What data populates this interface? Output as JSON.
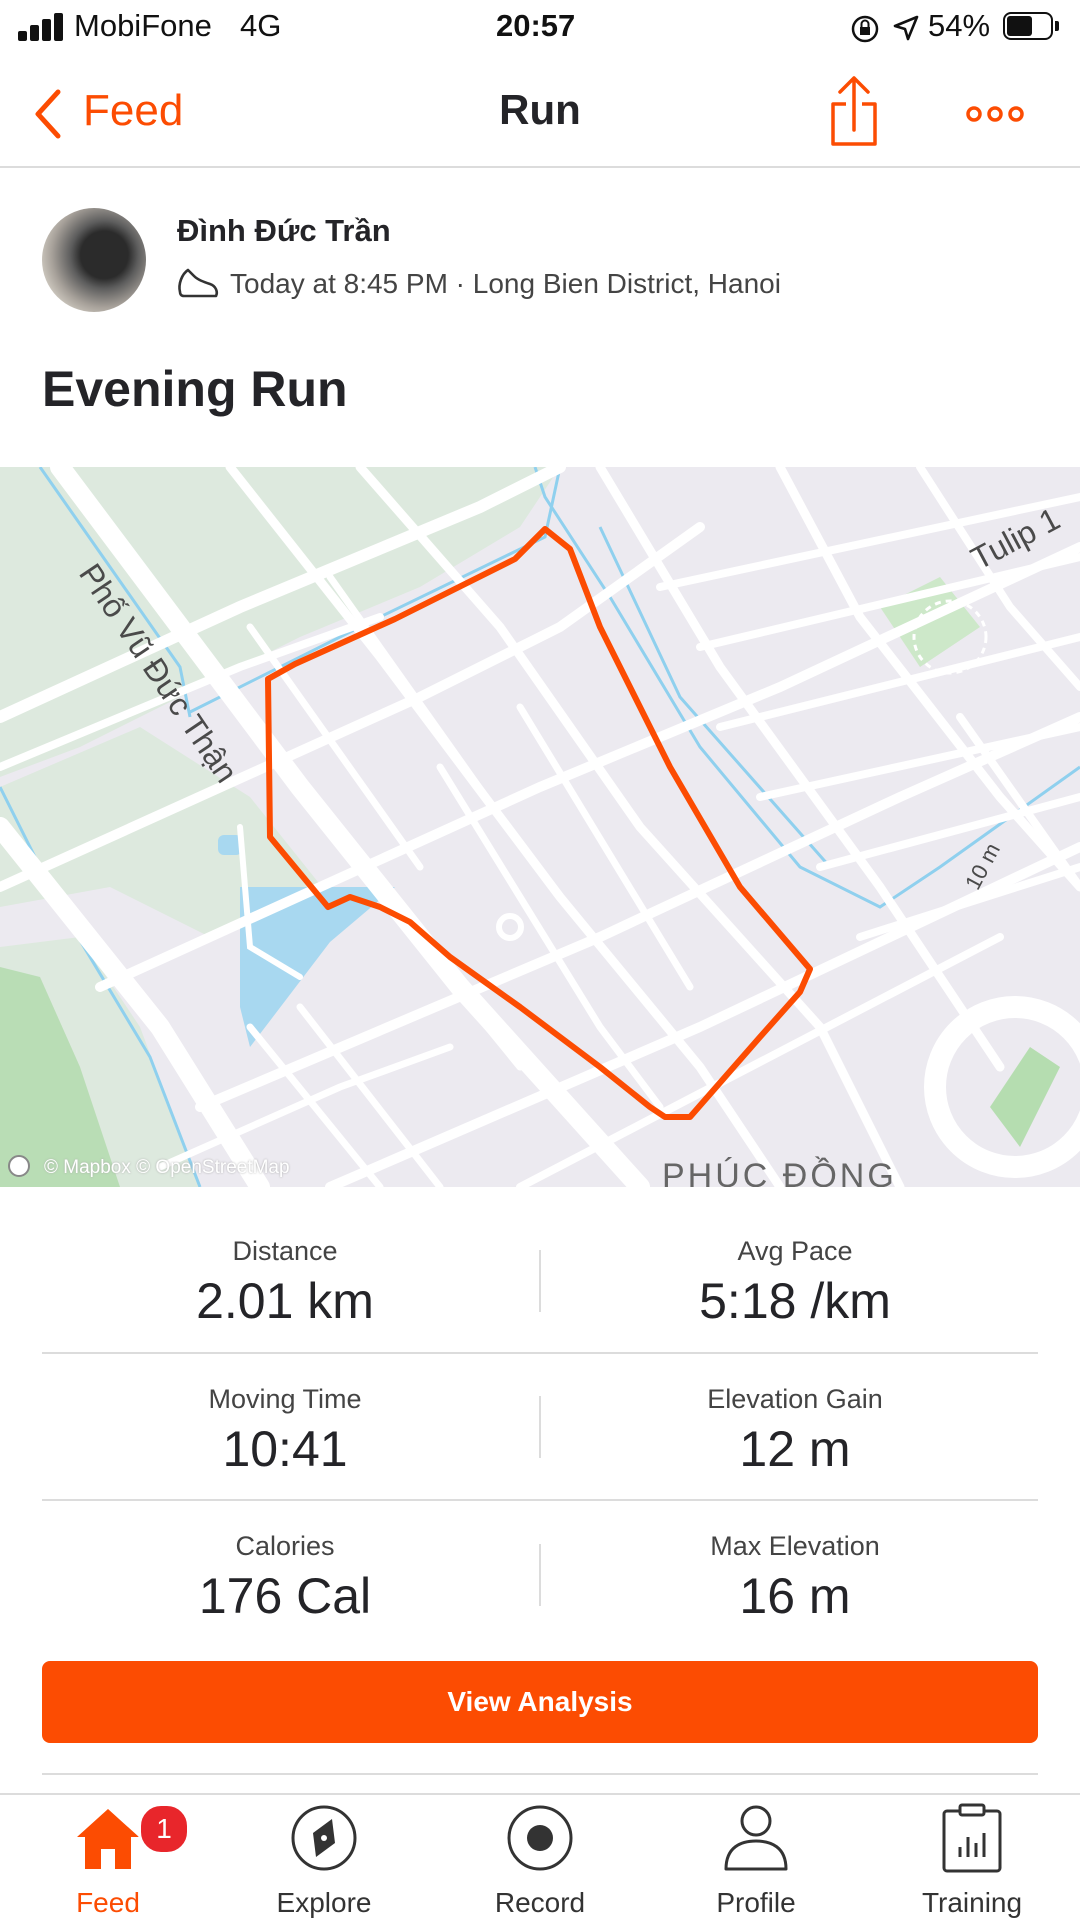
{
  "status_bar": {
    "carrier": "MobiFone",
    "network": "4G",
    "time": "20:57",
    "battery": "54%"
  },
  "nav": {
    "back_label": "Feed",
    "title": "Run",
    "share_icon": "share-icon",
    "more_icon": "more-icon"
  },
  "activity": {
    "athlete_name": "Đình Đức Trần",
    "meta": "Today at 8:45 PM · Long Bien District, Hanoi",
    "title": "Evening Run"
  },
  "map": {
    "labels": {
      "street_1": "Phố Vũ Đức Thận",
      "street_2": "Tulip 1",
      "contour": "10 m",
      "district": "PHÚC ĐỒNG"
    },
    "attribution": "© Mapbox © OpenStreetMap",
    "route_color": "#fc4c02",
    "water_color": "#a8d8f0",
    "park_color": "#dde9de"
  },
  "stats": [
    {
      "label": "Distance",
      "value": "2.01 km"
    },
    {
      "label": "Avg Pace",
      "value": "5:18 /km"
    },
    {
      "label": "Moving Time",
      "value": "10:41"
    },
    {
      "label": "Elevation Gain",
      "value": "12 m"
    },
    {
      "label": "Calories",
      "value": "176 Cal"
    },
    {
      "label": "Max Elevation",
      "value": "16 m"
    }
  ],
  "cta": {
    "label": "View Analysis"
  },
  "tabs": [
    {
      "label": "Feed",
      "icon": "home-icon",
      "badge": "1",
      "active": true
    },
    {
      "label": "Explore",
      "icon": "compass-icon"
    },
    {
      "label": "Record",
      "icon": "record-icon"
    },
    {
      "label": "Profile",
      "icon": "profile-icon"
    },
    {
      "label": "Training",
      "icon": "training-icon"
    }
  ],
  "colors": {
    "accent": "#fc4c02",
    "text": "#242428",
    "divider": "#dcdcdc"
  }
}
